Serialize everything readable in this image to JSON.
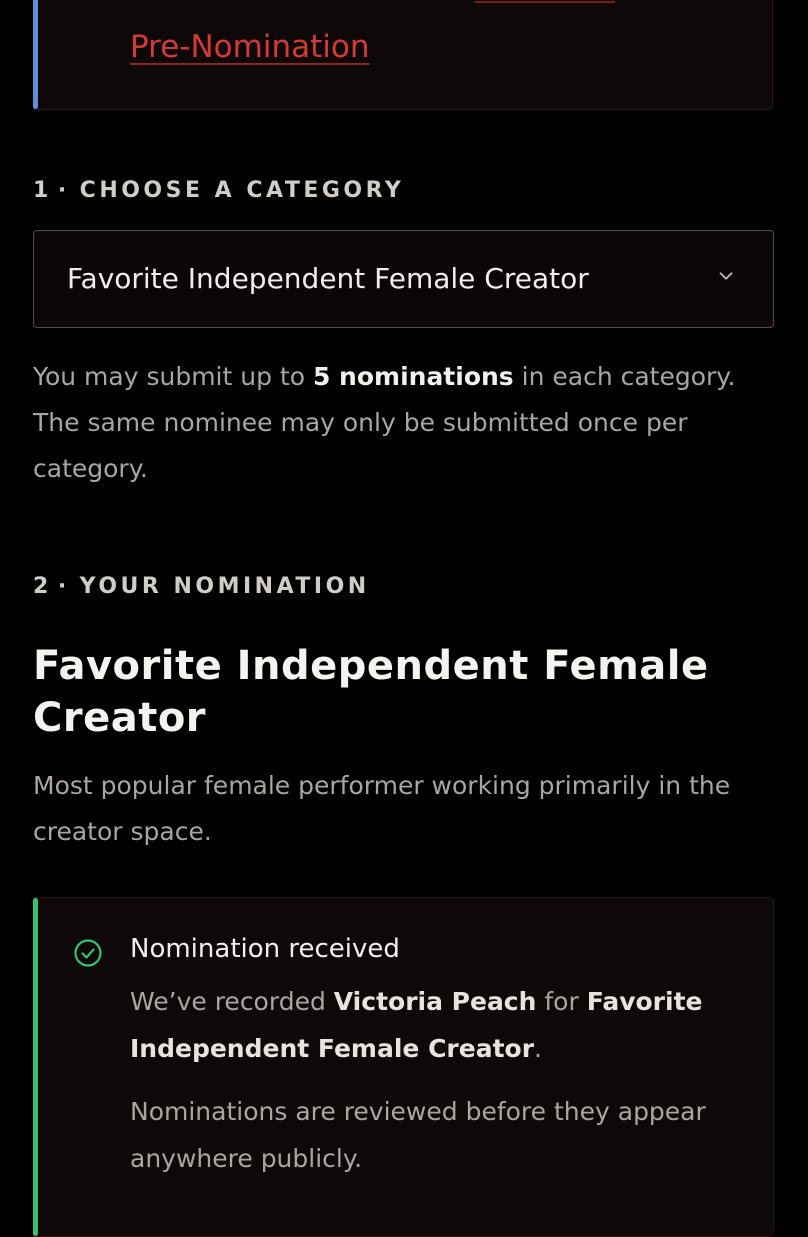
{
  "top_card": {
    "link_text": "Pre-Nomination",
    "accent_color": "#5f8fd6"
  },
  "step1": {
    "number": "1",
    "separator": "·",
    "label": "CHOOSE A CATEGORY"
  },
  "category_select": {
    "value": "Favorite Independent Female Creator",
    "icon": "chevron-down-icon"
  },
  "rules": {
    "part1": "You may submit up to ",
    "bold": "5 nominations",
    "part2": " in each category. The same nominee may only be submitted once per category."
  },
  "step2": {
    "number": "2",
    "separator": "·",
    "label": "YOUR NOMINATION"
  },
  "nomination": {
    "title": "Favorite Independent Female Creator",
    "description": "Most popular female performer working primarily in the creator space."
  },
  "success": {
    "icon": "check-circle-icon",
    "accent_color": "#37c26d",
    "title": "Nomination received",
    "msg_prefix": "We’ve recorded ",
    "nominee": "Victoria Peach",
    "msg_middle": " for ",
    "category": "Favorite Independent Female Creator",
    "msg_suffix": ".",
    "note": "Nominations are reviewed before they appear anywhere publicly."
  },
  "colors": {
    "background": "#000000",
    "link": "#d23a37",
    "text_muted": "#a9a6a2",
    "text_strong": "#f2f0ed"
  }
}
